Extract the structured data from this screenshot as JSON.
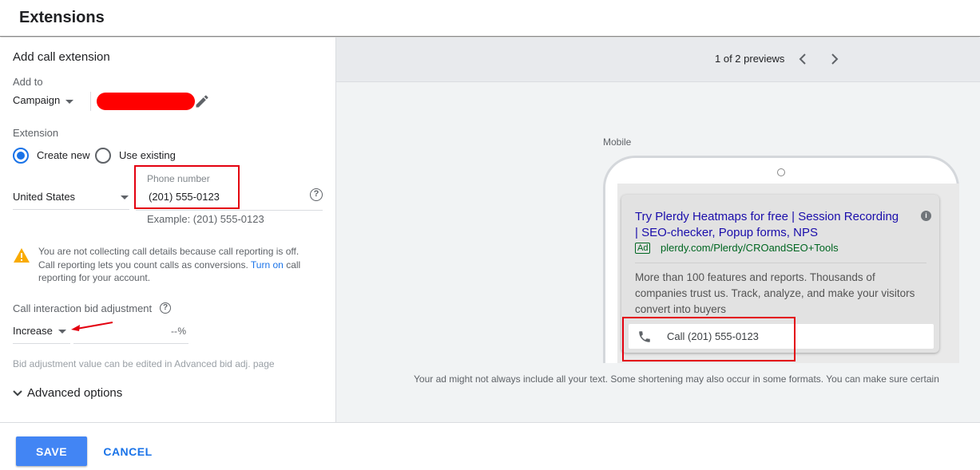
{
  "header": {
    "title": "Extensions"
  },
  "form": {
    "title": "Add call extension",
    "add_to_label": "Add to",
    "add_to_value": "Campaign",
    "extension_label": "Extension",
    "create_new_label": "Create new",
    "use_existing_label": "Use existing",
    "country_value": "United States",
    "phone_label": "Phone number",
    "phone_value": "(201) 555-0123",
    "phone_example": "Example: (201) 555-0123",
    "warning_text_1": "You are not collecting call details because call reporting is off.",
    "warning_text_2": "Call reporting lets you count calls as conversions.",
    "warning_link": "Turn on",
    "warning_text_3": "call",
    "warning_text_4": "reporting for your account.",
    "bid_label": "Call interaction bid adjustment",
    "bid_direction": "Increase",
    "bid_value": "--",
    "bid_unit": "%",
    "bid_note": "Bid adjustment value can be edited in Advanced bid adj. page",
    "advanced_label": "Advanced options"
  },
  "preview": {
    "counter": "1 of 2 previews",
    "device_label": "Mobile",
    "ad_title_1": "Try Plerdy Heatmaps for free | Session Recording",
    "ad_title_2": "| SEO-checker, Popup forms, NPS",
    "ad_badge": "Ad",
    "ad_url": "plerdy.com/Plerdy/CROandSEO+Tools",
    "ad_desc_1": "More than 100 features and reports. Thousands of",
    "ad_desc_2": "companies trust us. Track, analyze, and make your visitors",
    "ad_desc_3": "convert into buyers",
    "call_text": "Call (201) 555-0123",
    "disclaimer": "Your ad might not always include all your text. Some shortening may also occur in some formats. You can make sure certain"
  },
  "footer": {
    "save_label": "SAVE",
    "cancel_label": "CANCEL"
  },
  "colors": {
    "accent": "#1a73e8",
    "save": "#4285f4",
    "annotation": "#e3000f",
    "ad_title": "#1a0dab",
    "ad_url": "#006621",
    "warning": "#f9ab00"
  }
}
